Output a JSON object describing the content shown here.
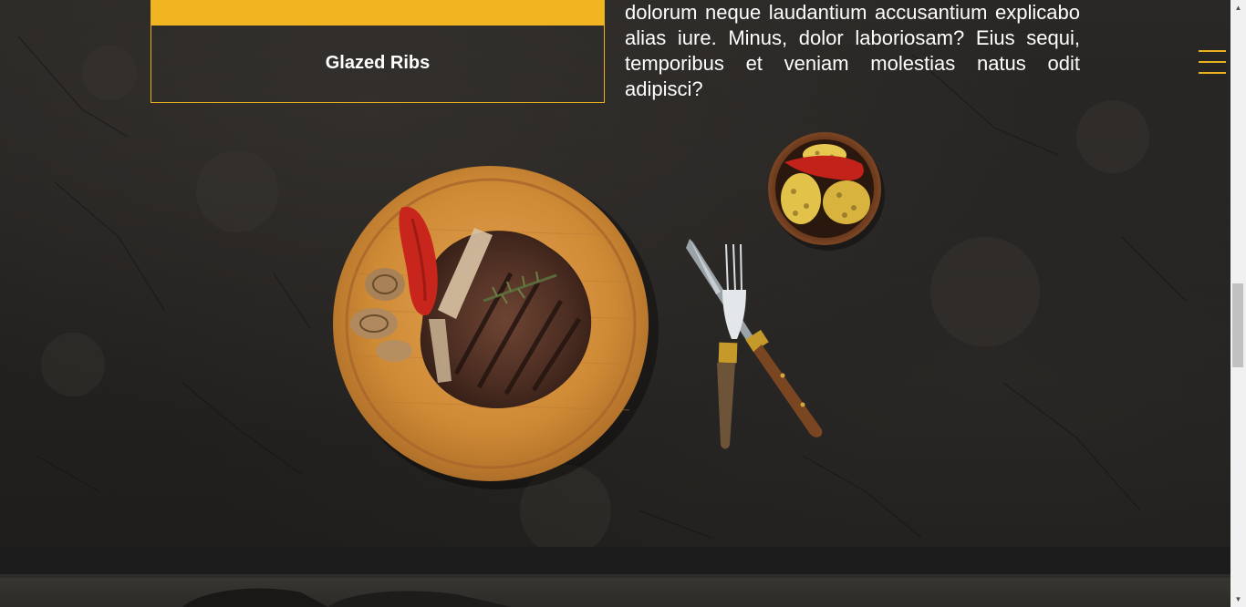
{
  "menu_card": {
    "title": "Glazed Ribs",
    "accent_color": "#f0b521"
  },
  "description": {
    "text": "dolorum neque laudantium accusantium explicabo alias iure. Minus, dolor laboriosam? Eius sequi, temporibus et veniam molestias natus odit adipisci?"
  },
  "navigation": {
    "menu_icon": "hamburger-menu-icon"
  },
  "scrollbar": {
    "up_arrow": "▲",
    "down_arrow": "▼"
  },
  "scene": {
    "items": [
      "steak-on-wooden-board",
      "grilled-red-pepper",
      "grilled-onion",
      "rosemary-sprig",
      "fork",
      "knife",
      "bowl-of-grilled-corn-and-pepper"
    ]
  }
}
